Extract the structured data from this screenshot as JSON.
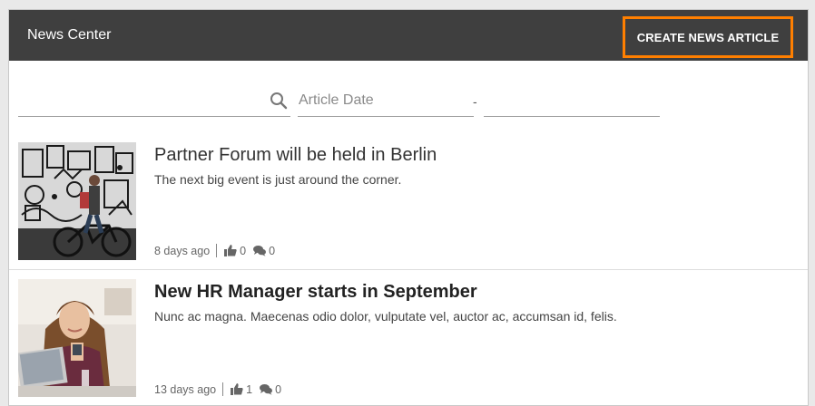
{
  "header": {
    "title": "News Center",
    "create_button_label": "CREATE NEWS ARTICLE",
    "highlight_color": "#ff7f00"
  },
  "filters": {
    "search_icon": "search-icon",
    "date_placeholder": "Article Date",
    "date_separator": "-"
  },
  "articles": [
    {
      "title": "Partner Forum will be held in Berlin",
      "description": "The next big event is just around the corner.",
      "age": "8 days ago",
      "likes": "0",
      "comments": "0"
    },
    {
      "title": "New HR Manager starts in September",
      "description": "Nunc ac magna. Maecenas odio dolor, vulputate vel, auctor ac, accumsan id, felis.",
      "age": "13 days ago",
      "likes": "1",
      "comments": "0"
    }
  ]
}
